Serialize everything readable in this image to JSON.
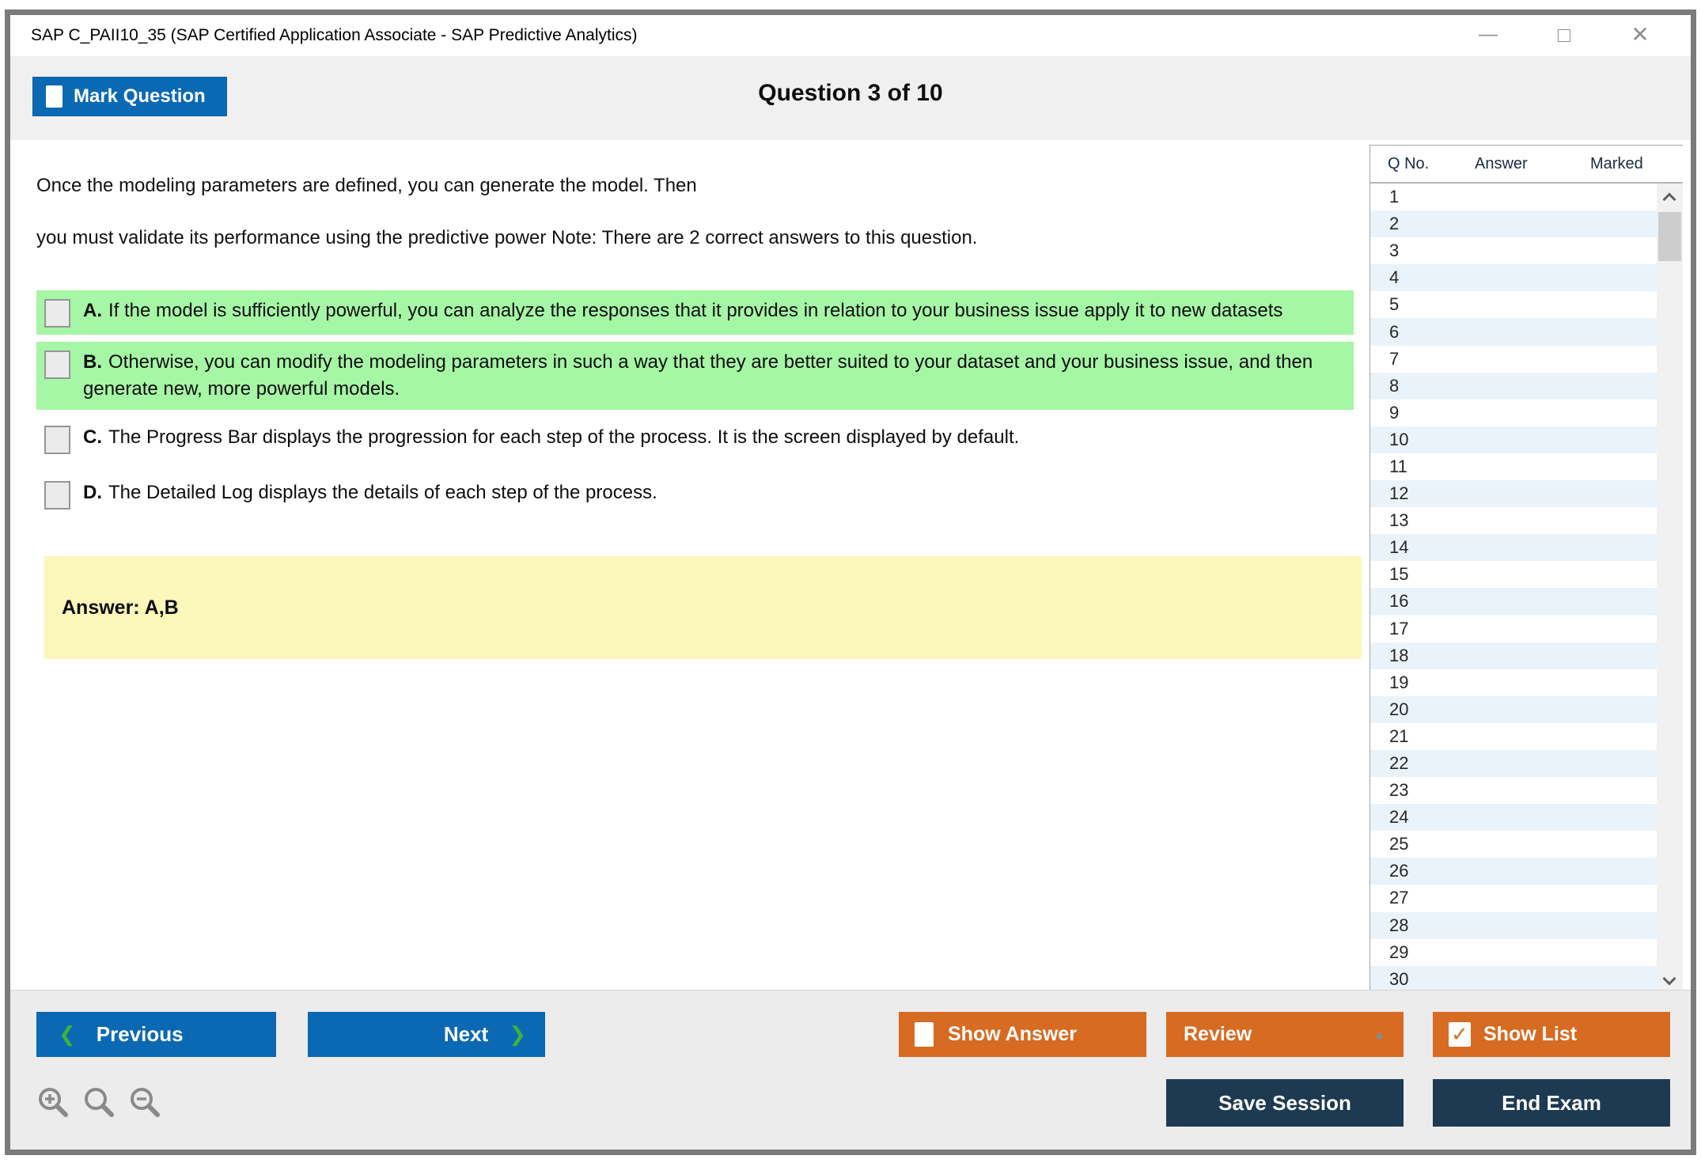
{
  "window": {
    "title": "SAP C_PAII10_35 (SAP Certified Application Associate - SAP Predictive Analytics)",
    "controls": {
      "minimize": "—",
      "maximize": "□",
      "close": "✕"
    }
  },
  "header": {
    "mark_question_label": "Mark Question",
    "question_counter": "Question 3 of 10"
  },
  "question": {
    "text_lines": [
      "Once the modeling parameters are defined, you can generate the model. Then",
      "you must validate its performance using the predictive power Note: There are 2 correct answers to this question."
    ],
    "options": [
      {
        "letter": "A.",
        "text": "If the model is sufficiently powerful, you can analyze the responses that it provides in relation to your business issue apply it to new datasets",
        "highlighted": true
      },
      {
        "letter": "B.",
        "text": "Otherwise, you can modify the modeling parameters in such a way that they are better suited to your dataset and your business issue, and then generate new, more powerful models.",
        "highlighted": true
      },
      {
        "letter": "C.",
        "text": "The Progress Bar displays the progression for each step of the process. It is the screen displayed by default.",
        "highlighted": false
      },
      {
        "letter": "D.",
        "text": "The Detailed Log displays the details of each step of the process.",
        "highlighted": false
      }
    ],
    "answer_label": "Answer: A,B"
  },
  "sidebar": {
    "columns": {
      "qno": "Q No.",
      "answer": "Answer",
      "marked": "Marked"
    },
    "rows": [
      {
        "q": "1",
        "answer": "",
        "marked": ""
      },
      {
        "q": "2",
        "answer": "",
        "marked": ""
      },
      {
        "q": "3",
        "answer": "",
        "marked": ""
      },
      {
        "q": "4",
        "answer": "",
        "marked": ""
      },
      {
        "q": "5",
        "answer": "",
        "marked": ""
      },
      {
        "q": "6",
        "answer": "",
        "marked": ""
      },
      {
        "q": "7",
        "answer": "",
        "marked": ""
      },
      {
        "q": "8",
        "answer": "",
        "marked": ""
      },
      {
        "q": "9",
        "answer": "",
        "marked": ""
      },
      {
        "q": "10",
        "answer": "",
        "marked": ""
      },
      {
        "q": "11",
        "answer": "",
        "marked": ""
      },
      {
        "q": "12",
        "answer": "",
        "marked": ""
      },
      {
        "q": "13",
        "answer": "",
        "marked": ""
      },
      {
        "q": "14",
        "answer": "",
        "marked": ""
      },
      {
        "q": "15",
        "answer": "",
        "marked": ""
      },
      {
        "q": "16",
        "answer": "",
        "marked": ""
      },
      {
        "q": "17",
        "answer": "",
        "marked": ""
      },
      {
        "q": "18",
        "answer": "",
        "marked": ""
      },
      {
        "q": "19",
        "answer": "",
        "marked": ""
      },
      {
        "q": "20",
        "answer": "",
        "marked": ""
      },
      {
        "q": "21",
        "answer": "",
        "marked": ""
      },
      {
        "q": "22",
        "answer": "",
        "marked": ""
      },
      {
        "q": "23",
        "answer": "",
        "marked": ""
      },
      {
        "q": "24",
        "answer": "",
        "marked": ""
      },
      {
        "q": "25",
        "answer": "",
        "marked": ""
      },
      {
        "q": "26",
        "answer": "",
        "marked": ""
      },
      {
        "q": "27",
        "answer": "",
        "marked": ""
      },
      {
        "q": "28",
        "answer": "",
        "marked": ""
      },
      {
        "q": "29",
        "answer": "",
        "marked": ""
      },
      {
        "q": "30",
        "answer": "",
        "marked": ""
      }
    ]
  },
  "footer": {
    "previous_label": "Previous",
    "next_label": "Next",
    "show_answer_label": "Show Answer",
    "review_label": "Review",
    "show_list_label": "Show List",
    "save_session_label": "Save Session",
    "end_exam_label": "End Exam"
  },
  "icons": {
    "previous_chevron": "❮",
    "next_chevron": "❯",
    "review_caret": "▲",
    "show_list_check": "✓",
    "scroll_up": "chevron-up",
    "scroll_down": "chevron-down",
    "zoom_in": "magnifier-plus",
    "magnifier": "magnifier",
    "zoom_out": "magnifier-minus"
  },
  "colors": {
    "accent_blue": "#0b69b4",
    "accent_orange": "#d76b21",
    "accent_navy": "#1e3a52",
    "highlight_green": "#a5f6a5",
    "answer_yellow": "#fcf7ba",
    "row_stripe": "#eaf3fa",
    "chrome_gray": "#f0f0f0"
  }
}
